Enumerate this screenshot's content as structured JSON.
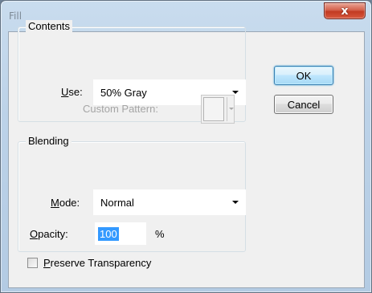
{
  "window": {
    "title": "Fill",
    "close_glyph": "x"
  },
  "contents": {
    "legend": "Contents",
    "use_label_accel": "U",
    "use_label_rest": "se:",
    "use_value": "50% Gray",
    "custom_pattern_label": "Custom Pattern:"
  },
  "blending": {
    "legend": "Blending",
    "mode_label_accel": "M",
    "mode_label_rest": "ode:",
    "mode_value": "Normal",
    "opacity_label_accel": "O",
    "opacity_label_rest": "pacity:",
    "opacity_value": "100",
    "opacity_unit": "%",
    "preserve_accel": "P",
    "preserve_rest": "reserve Transparency",
    "preserve_checked": false
  },
  "buttons": {
    "ok": "OK",
    "cancel": "Cancel"
  }
}
